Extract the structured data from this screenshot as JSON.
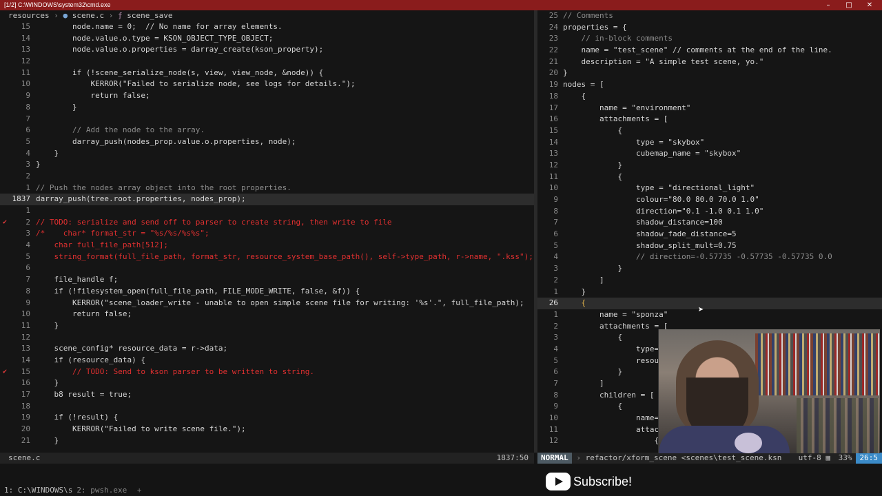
{
  "window": {
    "title": "[1/2] C:\\WINDOWS\\system32\\cmd.exe",
    "min_icon": "minimize-icon",
    "max_icon": "maximize-icon",
    "close_icon": "close-icon"
  },
  "left": {
    "breadcrumb": [
      "resources",
      "scene.c",
      "scene_save"
    ],
    "lines": [
      {
        "n": "15",
        "code": "        node.name = 0;  // No name for array elements.",
        "kind": "mixed"
      },
      {
        "n": "14",
        "code": "        node.value.o.type = KSON_OBJECT_TYPE_OBJECT;"
      },
      {
        "n": "13",
        "code": "        node.value.o.properties = darray_create(kson_property);"
      },
      {
        "n": "12",
        "code": ""
      },
      {
        "n": "11",
        "code": "        if (!scene_serialize_node(s, view, view_node, &node)) {"
      },
      {
        "n": "10",
        "code": "            KERROR(\"Failed to serialize node, see logs for details.\");"
      },
      {
        "n": "9",
        "code": "            return false;"
      },
      {
        "n": "8",
        "code": "        }"
      },
      {
        "n": "7",
        "code": ""
      },
      {
        "n": "6",
        "code": "        // Add the node to the array.",
        "kind": "comment"
      },
      {
        "n": "5",
        "code": "        darray_push(nodes_prop.value.o.properties, node);"
      },
      {
        "n": "4",
        "code": "    }"
      },
      {
        "n": "3",
        "code": "}"
      },
      {
        "n": "2",
        "code": ""
      },
      {
        "n": "1",
        "code": "// Push the nodes array object into the root properties.",
        "kind": "comment"
      },
      {
        "n": "1837",
        "code": "darray_push(tree.root.properties, nodes_prop);",
        "kind": "current"
      },
      {
        "n": "1",
        "code": ""
      },
      {
        "n": "2",
        "code": "// TODO: serialize and send off to parser to create string, then write to file",
        "kind": "todo",
        "sign": true
      },
      {
        "n": "3",
        "code": "/*    char* format_str = \"%s/%s/%s%s\";",
        "kind": "todo"
      },
      {
        "n": "4",
        "code": "    char full_file_path[512];",
        "kind": "todo"
      },
      {
        "n": "5",
        "code": "    string_format(full_file_path, format_str, resource_system_base_path(), self->type_path, r->name, \".kss\");",
        "kind": "todo"
      },
      {
        "n": "6",
        "code": ""
      },
      {
        "n": "7",
        "code": "    file_handle f;"
      },
      {
        "n": "8",
        "code": "    if (!filesystem_open(full_file_path, FILE_MODE_WRITE, false, &f)) {"
      },
      {
        "n": "9",
        "code": "        KERROR(\"scene_loader_write - unable to open simple scene file for writing: '%s'.\", full_file_path);"
      },
      {
        "n": "10",
        "code": "        return false;"
      },
      {
        "n": "11",
        "code": "    }"
      },
      {
        "n": "12",
        "code": ""
      },
      {
        "n": "13",
        "code": "    scene_config* resource_data = r->data;"
      },
      {
        "n": "14",
        "code": "    if (resource_data) {"
      },
      {
        "n": "15",
        "code": "        // TODO: Send to kson parser to be written to string.",
        "kind": "todo",
        "sign": true
      },
      {
        "n": "16",
        "code": "    }"
      },
      {
        "n": "17",
        "code": "    b8 result = true;"
      },
      {
        "n": "18",
        "code": ""
      },
      {
        "n": "19",
        "code": "    if (!result) {"
      },
      {
        "n": "20",
        "code": "        KERROR(\"Failed to write scene file.\");"
      },
      {
        "n": "21",
        "code": "    }"
      }
    ],
    "status": {
      "file": "scene.c",
      "position": "1837:50"
    }
  },
  "right": {
    "lines": [
      {
        "n": "25",
        "code": "// Comments"
      },
      {
        "n": "24",
        "code": "properties = {"
      },
      {
        "n": "23",
        "code": "    // in-block comments"
      },
      {
        "n": "22",
        "code": "    name = \"test_scene\" // comments at the end of the line."
      },
      {
        "n": "21",
        "code": "    description = \"A simple test scene, yo.\""
      },
      {
        "n": "20",
        "code": "}"
      },
      {
        "n": "19",
        "code": "nodes = ["
      },
      {
        "n": "18",
        "code": "    {"
      },
      {
        "n": "17",
        "code": "        name = \"environment\""
      },
      {
        "n": "16",
        "code": "        attachments = ["
      },
      {
        "n": "15",
        "code": "            {"
      },
      {
        "n": "14",
        "code": "                type = \"skybox\""
      },
      {
        "n": "13",
        "code": "                cubemap_name = \"skybox\""
      },
      {
        "n": "12",
        "code": "            }"
      },
      {
        "n": "11",
        "code": "            {"
      },
      {
        "n": "10",
        "code": "                type = \"directional_light\""
      },
      {
        "n": "9",
        "code": "                colour=\"80.0 80.0 70.0 1.0\""
      },
      {
        "n": "8",
        "code": "                direction=\"0.1 -1.0 0.1 1.0\""
      },
      {
        "n": "7",
        "code": "                shadow_distance=100"
      },
      {
        "n": "6",
        "code": "                shadow_fade_distance=5"
      },
      {
        "n": "5",
        "code": "                shadow_split_mult=0.75"
      },
      {
        "n": "4",
        "code": "                // direction=-0.57735 -0.57735 -0.57735 0.0"
      },
      {
        "n": "3",
        "code": "            }"
      },
      {
        "n": "2",
        "code": "        ]"
      },
      {
        "n": "1",
        "code": "    }"
      },
      {
        "n": "26",
        "code": "    {",
        "kind": "current"
      },
      {
        "n": "1",
        "code": "        name = \"sponza\""
      },
      {
        "n": "2",
        "code": "        attachments = ["
      },
      {
        "n": "3",
        "code": "            {"
      },
      {
        "n": "4",
        "code": "                type=\""
      },
      {
        "n": "5",
        "code": "                resour"
      },
      {
        "n": "6",
        "code": "            }"
      },
      {
        "n": "7",
        "code": "        ]"
      },
      {
        "n": "8",
        "code": "        children = ["
      },
      {
        "n": "9",
        "code": "            {"
      },
      {
        "n": "10",
        "code": "                name=\""
      },
      {
        "n": "11",
        "code": "                attach"
      },
      {
        "n": "12",
        "code": "                    {"
      }
    ],
    "status": {
      "mode": "NORMAL",
      "branch": "refactor/xform_scene",
      "file": "<scenes\\test_scene.ksn",
      "encoding": "utf-8",
      "percent": "33%",
      "position": "26:5"
    }
  },
  "tmux": {
    "active": "1: C:\\WINDOWS\\s",
    "inactive": "2: pwsh.exe"
  },
  "overlay": {
    "subscribe": "Subscribe!",
    "icon": "youtube-play-icon"
  }
}
